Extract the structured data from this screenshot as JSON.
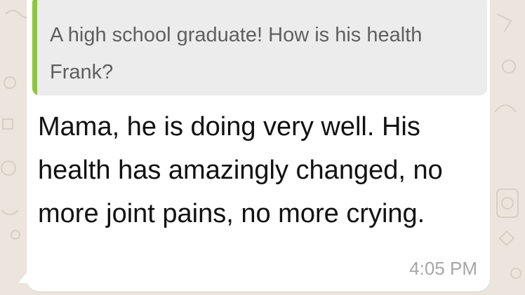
{
  "quoted_message": {
    "text": "A high school graduate! How is his health Frank?",
    "accent_color": "#8cc63f"
  },
  "message": {
    "text": "Mama, he is doing very well. His health has amazingly changed, no more joint pains, no more crying.",
    "time": "4:05 PM"
  },
  "colors": {
    "chat_background": "#ece5dd",
    "bubble": "#ffffff",
    "quote_background": "#ececec"
  }
}
